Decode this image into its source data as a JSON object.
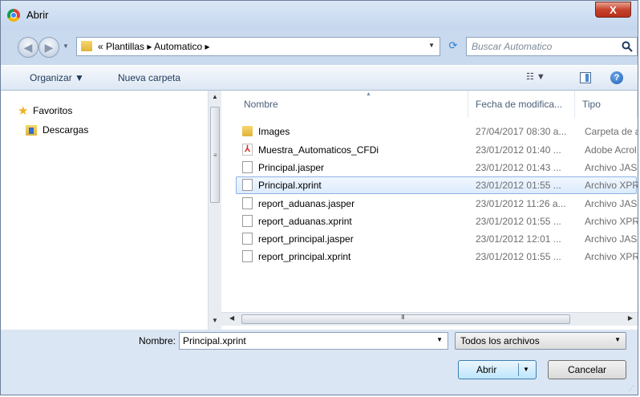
{
  "window": {
    "title": "Abrir",
    "close_glyph": "X"
  },
  "address": {
    "prefix": "«",
    "crumbs": "Plantillas  ▸  Automatico  ▸",
    "search_placeholder": "Buscar Automatico"
  },
  "toolbar": {
    "organize_label": "Organizar ▼",
    "new_folder_label": "Nueva carpeta"
  },
  "nav": {
    "items": [
      {
        "label": "Favoritos",
        "icon": "star-icon"
      },
      {
        "label": "Descargas",
        "icon": "downloads-folder-icon"
      }
    ]
  },
  "files": {
    "columns": {
      "name": "Nombre",
      "date": "Fecha de modifica...",
      "type": "Tipo"
    },
    "rows": [
      {
        "name": "Images",
        "date": "27/04/2017 08:30 a...",
        "type": "Carpeta de a",
        "icon": "folder-icon"
      },
      {
        "name": "Muestra_Automaticos_CFDi",
        "date": "23/01/2012 01:40 ...",
        "type": "Adobe Acrol",
        "icon": "pdf-icon"
      },
      {
        "name": "Principal.jasper",
        "date": "23/01/2012 01:43 ...",
        "type": "Archivo JASI",
        "icon": "file-icon"
      },
      {
        "name": "Principal.xprint",
        "date": "23/01/2012 01:55 ...",
        "type": "Archivo XPR",
        "icon": "file-icon",
        "selected": true
      },
      {
        "name": "report_aduanas.jasper",
        "date": "23/01/2012 11:26 a...",
        "type": "Archivo JASI",
        "icon": "file-icon"
      },
      {
        "name": "report_aduanas.xprint",
        "date": "23/01/2012 01:55 ...",
        "type": "Archivo XPR",
        "icon": "file-icon"
      },
      {
        "name": "report_principal.jasper",
        "date": "23/01/2012 12:01 ...",
        "type": "Archivo JASI",
        "icon": "file-icon"
      },
      {
        "name": "report_principal.xprint",
        "date": "23/01/2012 01:55 ...",
        "type": "Archivo XPR",
        "icon": "file-icon"
      }
    ]
  },
  "bottom": {
    "filename_label": "Nombre:",
    "filename_value": "Principal.xprint",
    "filetype_value": "Todos los archivos",
    "open_label": "Abrir",
    "cancel_label": "Cancelar"
  }
}
